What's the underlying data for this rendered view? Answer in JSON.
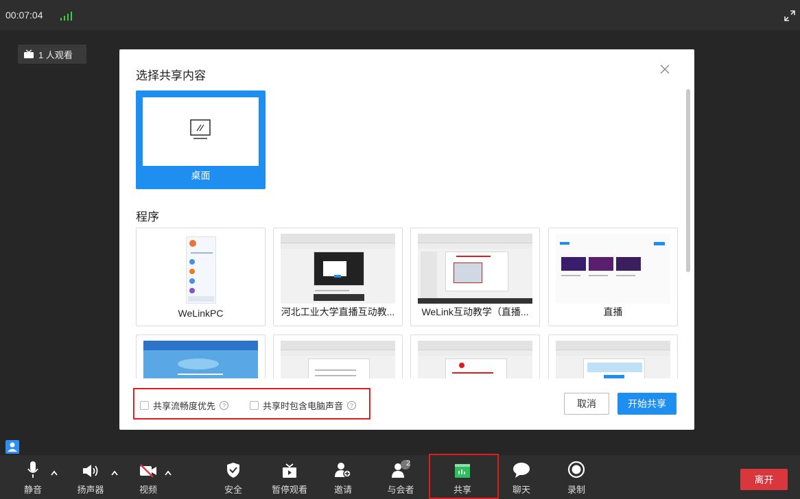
{
  "topbar": {
    "timer": "00:07:04"
  },
  "viewers": {
    "label": "1 人观看"
  },
  "modal": {
    "title": "选择共享内容",
    "desktop_label": "桌面",
    "section_programs": "程序",
    "apps": [
      {
        "name": "WeLinkPC"
      },
      {
        "name": "河北工业大学直播互动教..."
      },
      {
        "name": "WeLink互动教学（直播..."
      },
      {
        "name": "直播"
      }
    ],
    "options": {
      "smooth_label": "共享流畅度优先",
      "audio_label": "共享时包含电脑声音"
    },
    "cancel_label": "取消",
    "start_label": "开始共享"
  },
  "toolbar": {
    "mute": "静音",
    "speaker": "扬声器",
    "video": "视频",
    "security": "安全",
    "pause_view": "暂停观看",
    "invite": "邀请",
    "participants": "与会者",
    "participants_count": "2",
    "share": "共享",
    "chat": "聊天",
    "record": "录制",
    "leave": "离开"
  },
  "colors": {
    "accent": "#1e8ef0",
    "leave": "#d9363e",
    "highlight": "#e01d1d",
    "share_green": "#2fbf5f"
  }
}
